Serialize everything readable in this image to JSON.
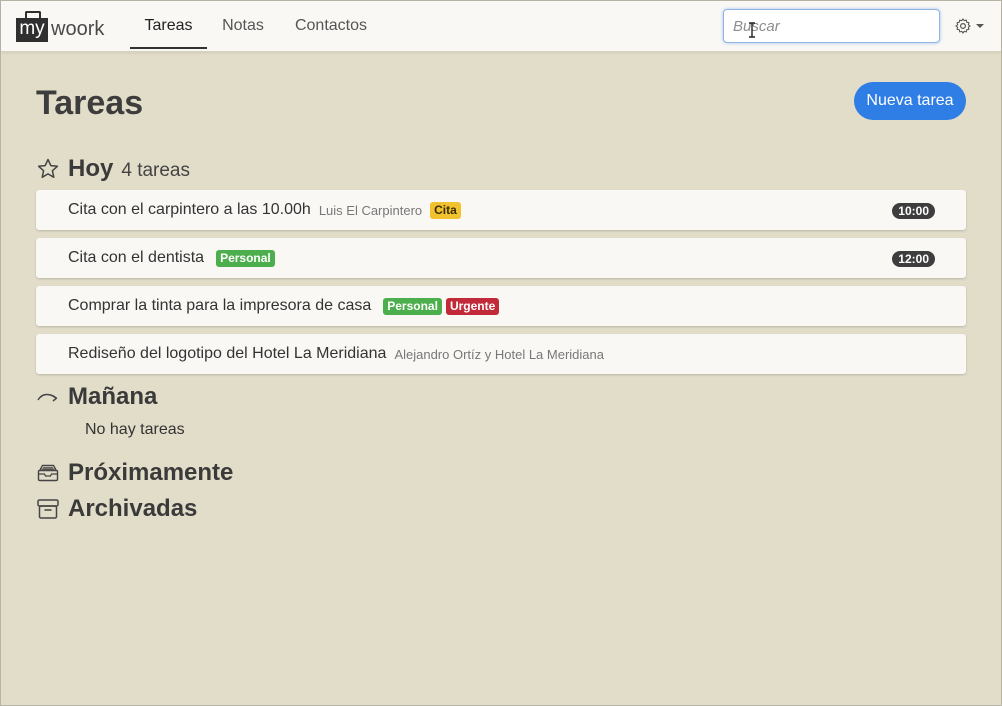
{
  "header": {
    "logo_box": "my",
    "logo_text": "woork",
    "tabs": [
      {
        "label": "Tareas",
        "active": true
      },
      {
        "label": "Notas",
        "active": false
      },
      {
        "label": "Contactos",
        "active": false
      }
    ],
    "search": {
      "placeholder": "Buscar",
      "value": ""
    },
    "settings_icon": "gear-icon"
  },
  "main": {
    "title": "Tareas",
    "new_task_label": "Nueva tarea",
    "sections": {
      "today": {
        "title": "Hoy",
        "count_label": "4 tareas",
        "icon": "star-icon",
        "tasks": [
          {
            "title": "Cita con el carpintero a las 10.00h",
            "contact": "Luis El Carpintero",
            "badges": [
              "Cita"
            ],
            "time": "10:00"
          },
          {
            "title": "Cita con el dentista",
            "contact": "",
            "badges": [
              "Personal"
            ],
            "time": "12:00"
          },
          {
            "title": "Comprar la tinta para la impresora de casa",
            "contact": "",
            "badges": [
              "Personal",
              "Urgente"
            ],
            "time": ""
          },
          {
            "title": "Rediseño del logotipo del Hotel La Meridiana",
            "contact": "Alejandro Ortíz y Hotel La Meridiana",
            "badges": [],
            "time": ""
          }
        ]
      },
      "tomorrow": {
        "title": "Mañana",
        "icon": "curved-arrow-icon",
        "empty_label": "No hay tareas"
      },
      "upcoming": {
        "title": "Próximamente",
        "icon": "inbox-tray-icon"
      },
      "archived": {
        "title": "Archivadas",
        "icon": "archive-box-icon"
      }
    }
  },
  "colors": {
    "background": "#e2ddc9",
    "primary_button": "#2e7ee6",
    "badge_cita": "#f2c12e",
    "badge_personal": "#4cae4c",
    "badge_urgente": "#c22a3a",
    "time_badge": "#3e3e3e"
  }
}
